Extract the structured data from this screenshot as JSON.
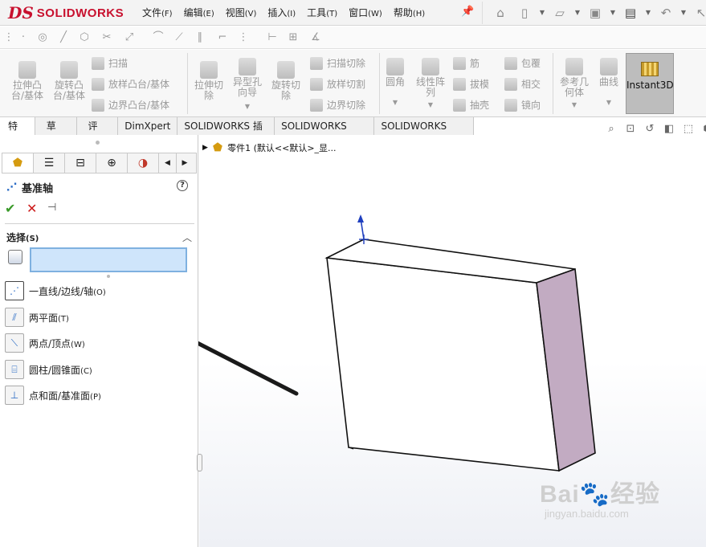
{
  "app": {
    "logo_mark": "DS",
    "logo_text": "SOLIDWORKS"
  },
  "menus": [
    {
      "label": "文件",
      "key": "(F)"
    },
    {
      "label": "编辑",
      "key": "(E)"
    },
    {
      "label": "视图",
      "key": "(V)"
    },
    {
      "label": "插入",
      "key": "(I)"
    },
    {
      "label": "工具",
      "key": "(T)"
    },
    {
      "label": "窗口",
      "key": "(W)"
    },
    {
      "label": "帮助",
      "key": "(H)"
    }
  ],
  "ribbon": {
    "extrude_boss": "拉伸凸\n台/基体",
    "revolve_boss": "旋转凸\n台/基体",
    "sweep": "扫描",
    "loft": "放样凸台/基体",
    "boundary": "边界凸台/基体",
    "extrude_cut": "拉伸切\n除",
    "hole_wizard": "异型孔\n向导",
    "revolve_cut": "旋转切\n除",
    "sweep_cut": "扫描切除",
    "loft_cut": "放样切割",
    "boundary_cut": "边界切除",
    "fillet": "圆角",
    "linear_pattern": "线性阵\n列",
    "rib": "筋",
    "draft": "拔模",
    "shell": "抽壳",
    "wrap": "包覆",
    "intersect": "相交",
    "mirror": "镜向",
    "ref_geometry": "参考几\n何体",
    "curves": "曲线",
    "instant3d": "Instant3D"
  },
  "tabs": [
    "特征",
    "草图",
    "评估",
    "DimXpert",
    "SOLIDWORKS 插件",
    "SOLIDWORKS MBD",
    "SOLIDWORKS CAM"
  ],
  "active_tab": "特征",
  "panel": {
    "title": "基准轴",
    "help": "?",
    "ok": "✔",
    "cancel": "✕",
    "section_label": "选择",
    "section_key": "(S)",
    "selection_value": "",
    "options": [
      {
        "label": "一直线/边线/轴",
        "key": "(O)"
      },
      {
        "label": "两平面",
        "key": "(T)"
      },
      {
        "label": "两点/顶点",
        "key": "(W)"
      },
      {
        "label": "圆柱/圆锥面",
        "key": "(C)"
      },
      {
        "label": "点和面/基准面",
        "key": "(P)"
      }
    ]
  },
  "viewport": {
    "tree_label": "零件1  (默认<<默认>_显..."
  },
  "colors": {
    "side_face": "#c2abc2",
    "arrow": "#1a1a1a",
    "brand_red": "#c8102e",
    "selection_fill": "#cfe5fb",
    "axis_blue": "#1f3fbf"
  },
  "watermark": {
    "brand": "Bai",
    "brand2": "经验",
    "url": "jingyan.baidu.com"
  }
}
